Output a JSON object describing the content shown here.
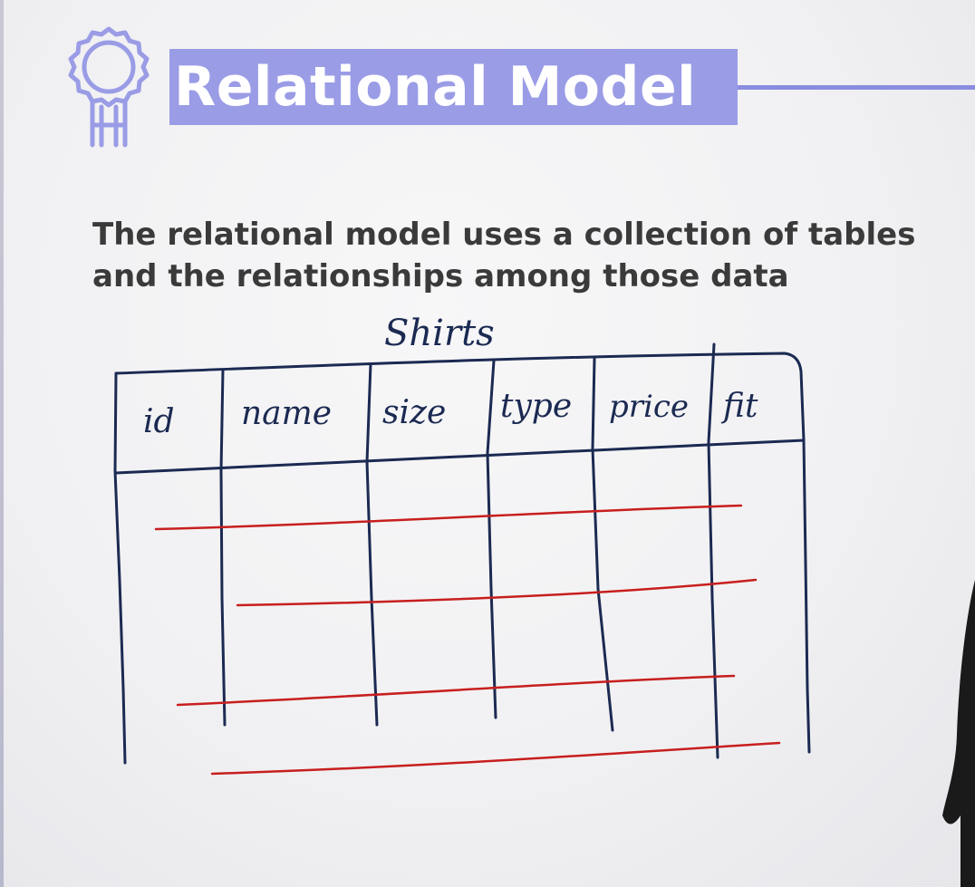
{
  "slide": {
    "title": "Relational Model",
    "body_line1": "The relational model uses a collection of tables",
    "body_line2": "and the relationships among those data"
  },
  "sketch": {
    "table_name": "Shirts",
    "columns": [
      "id",
      "name",
      "size",
      "type",
      "price",
      "fit"
    ],
    "ink_color": "#1b2a52",
    "row_line_color": "#c81e1e"
  },
  "icons": {
    "badge": "award-ribbon-icon"
  },
  "colors": {
    "title_band": "#9a9ce6",
    "title_text": "#ffffff",
    "body_text": "#3a3a3a"
  }
}
